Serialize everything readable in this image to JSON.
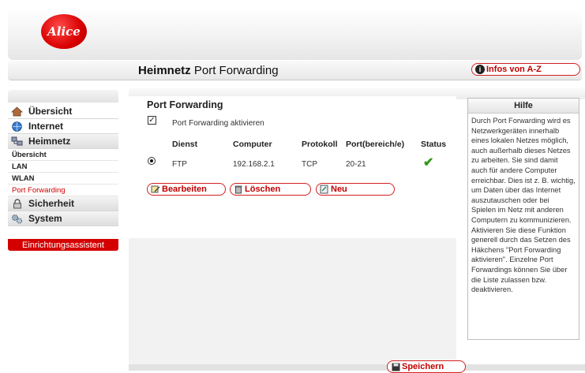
{
  "brand": {
    "logo_text": "Alice",
    "accent": "#d40000"
  },
  "header": {
    "title_bold": "Heimnetz",
    "title_rest": "Port Forwarding",
    "info_button": "Infos von A-Z"
  },
  "sidebar": {
    "items": [
      {
        "label": "Übersicht",
        "icon": "house-icon"
      },
      {
        "label": "Internet",
        "icon": "globe-icon"
      },
      {
        "label": "Heimnetz",
        "icon": "network-icon"
      },
      {
        "label": "Übersicht"
      },
      {
        "label": "LAN"
      },
      {
        "label": "WLAN"
      },
      {
        "label": "Port Forwarding"
      },
      {
        "label": "Sicherheit",
        "icon": "lock-icon"
      },
      {
        "label": "System",
        "icon": "gears-icon"
      }
    ],
    "assistant": "Einrichtungsassistent"
  },
  "main": {
    "section_title": "Port Forwarding",
    "enable_label": "Port Forwarding aktivieren",
    "enable_checked": true,
    "columns": [
      "Dienst",
      "Computer",
      "Protokoll",
      "Port(bereich/e)",
      "Status"
    ],
    "rows": [
      {
        "dienst": "FTP",
        "computer": "192.168.2.1",
        "protokoll": "TCP",
        "port": "20-21",
        "status": "ok"
      }
    ],
    "buttons": {
      "edit": "Bearbeiten",
      "delete": "Löschen",
      "new": "Neu",
      "save": "Speichern"
    }
  },
  "help": {
    "title": "Hilfe",
    "text": "Durch Port Forwarding wird es Netzwerkgeräten innerhalb eines lokalen Netzes möglich, auch außerhalb dieses Netzes zu arbeiten. Sie sind damit auch für andere Computer erreichbar. Dies ist z. B. wichtig, um Daten über das Internet auszutauschen oder bei Spielen im Netz mit anderen Computern zu kommunizieren. Aktivieren Sie diese Funktion generell durch das Setzen des Häkchens \"Port Forwarding aktivieren\". Einzelne Port Forwardings können Sie über die Liste zulassen bzw. deaktivieren."
  }
}
